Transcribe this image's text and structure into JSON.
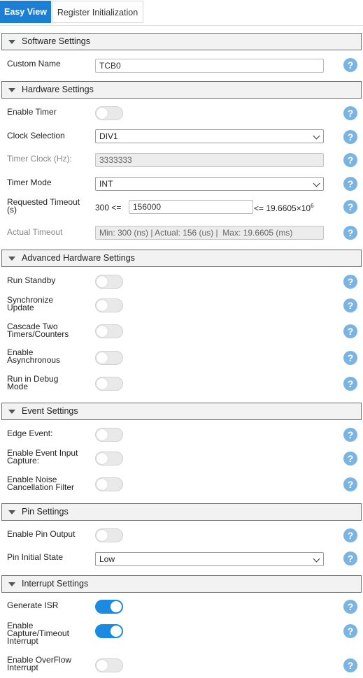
{
  "tabs": [
    {
      "label": "Easy View",
      "active": true
    },
    {
      "label": "Register Initialization",
      "active": false
    }
  ],
  "icons": {
    "help": "help-icon",
    "collapse": "triangle-down-icon",
    "dropdown": "chevron-down-icon"
  },
  "colors": {
    "accent": "#1b7fd6",
    "toggle_on": "#1a8be0",
    "help": "#7ab4e3"
  },
  "sections": {
    "software": {
      "title": "Software Settings",
      "custom_name": {
        "label": "Custom Name",
        "value": "TCB0"
      }
    },
    "hardware": {
      "title": "Hardware Settings",
      "enable_timer": {
        "label": "Enable Timer",
        "on": false
      },
      "clock_selection": {
        "label": "Clock Selection",
        "value": "DIV1"
      },
      "timer_clock": {
        "label": "Timer Clock (Hz):",
        "value": "3333333"
      },
      "timer_mode": {
        "label": "Timer Mode",
        "value": "INT"
      },
      "requested_timeout": {
        "label_line1": "Requested Timeout",
        "label_line2": "(s)",
        "min_text": "300 <=",
        "value": "156000",
        "max_text": "<= 19.6605×10",
        "max_exp": "6"
      },
      "actual_timeout": {
        "label": "Actual Timeout",
        "value": "Min: 300 (ns) | Actual: 156 (us) |  Max: 19.6605 (ms)"
      }
    },
    "advanced": {
      "title": "Advanced Hardware Settings",
      "run_standby": {
        "label": "Run Standby",
        "on": false
      },
      "sync_update": {
        "line1": "Synchronize",
        "line2": "Update",
        "on": false
      },
      "cascade": {
        "line1": "Cascade Two",
        "line2": "Timers/Counters",
        "on": false
      },
      "async": {
        "line1": "Enable",
        "line2": "Asynchronous",
        "on": false
      },
      "debug": {
        "line1": "Run in Debug",
        "line2": "Mode",
        "on": false
      }
    },
    "event": {
      "title": "Event Settings",
      "edge_event": {
        "label": "Edge Event:",
        "on": false
      },
      "input_capture": {
        "line1": "Enable Event Input",
        "line2": "Capture:",
        "on": false
      },
      "noise_filter": {
        "line1": "Enable Noise",
        "line2": "Cancellation Filter",
        "on": false
      }
    },
    "pin": {
      "title": "Pin Settings",
      "pin_output": {
        "label": "Enable Pin Output",
        "on": false
      },
      "pin_initial": {
        "label": "Pin Initial State",
        "value": "Low"
      }
    },
    "interrupt": {
      "title": "Interrupt Settings",
      "generate_isr": {
        "label": "Generate ISR",
        "on": true
      },
      "capture_timeout": {
        "line1": "Enable",
        "line2": "Capture/Timeout",
        "line3": "Interrupt",
        "on": true
      },
      "overflow": {
        "line1": "Enable OverFlow",
        "line2": "Interrupt",
        "on": false
      }
    }
  }
}
